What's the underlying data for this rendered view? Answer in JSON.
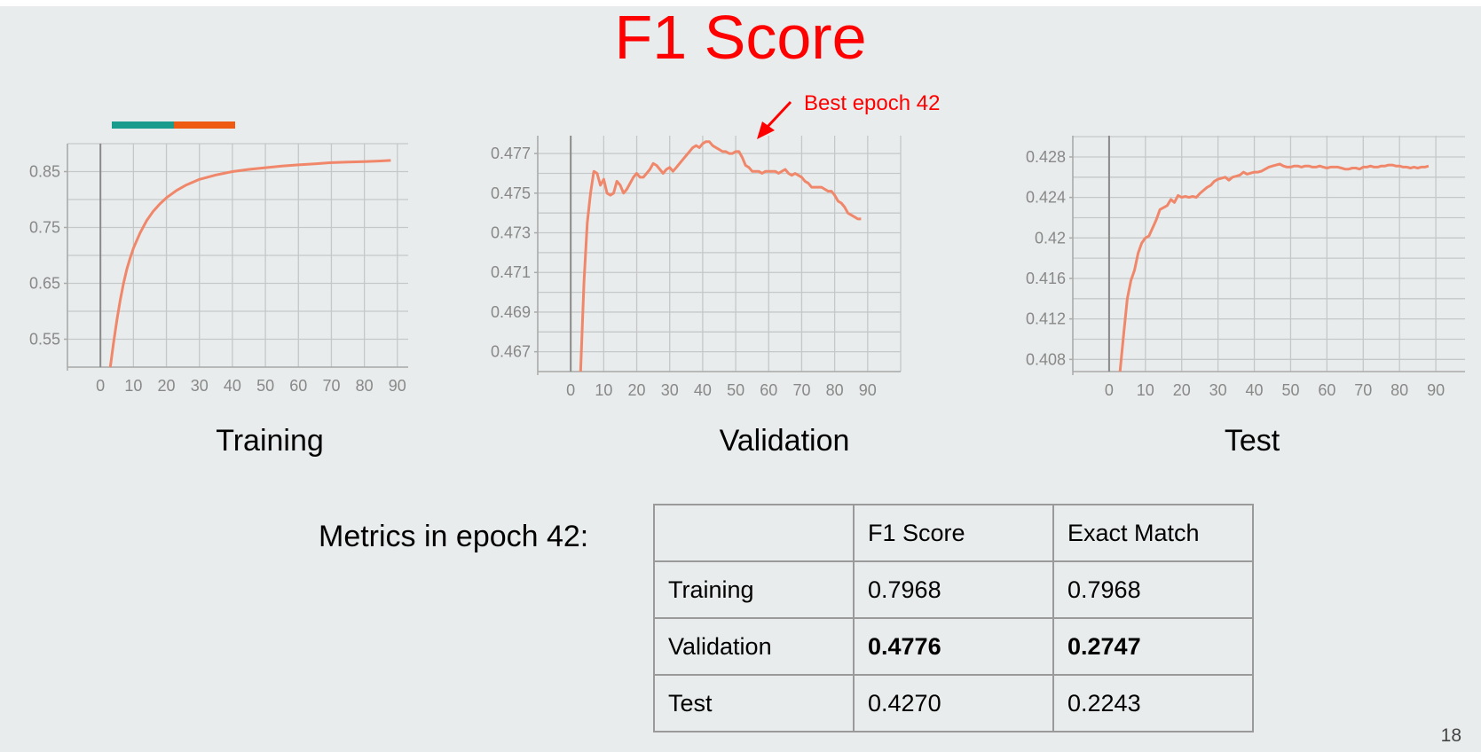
{
  "title": "F1 Score",
  "legend_colors": [
    "#1a9c8c",
    "#ef5a12"
  ],
  "annotation": {
    "text": "Best epoch 42",
    "color": "#ff0000"
  },
  "chart_data": [
    {
      "type": "line",
      "title": "Training",
      "xlabel": "",
      "ylabel": "",
      "x_ticks": [
        "0",
        "10",
        "20",
        "30",
        "40",
        "50",
        "60",
        "70",
        "80",
        "90"
      ],
      "y_ticks": [
        "0.85",
        "0.75",
        "0.65",
        "0.55"
      ],
      "xlim": [
        -10,
        100
      ],
      "ylim": [
        0.5,
        0.9
      ],
      "line_color": "#f0876a",
      "grid": true,
      "series": [
        {
          "x": [
            3,
            4,
            5,
            6,
            7,
            8,
            9,
            10,
            12,
            14,
            16,
            18,
            20,
            23,
            26,
            30,
            35,
            40,
            45,
            50,
            55,
            60,
            65,
            70,
            75,
            80,
            85,
            88
          ],
          "y": [
            0.5,
            0.545,
            0.585,
            0.62,
            0.65,
            0.675,
            0.695,
            0.713,
            0.74,
            0.762,
            0.779,
            0.792,
            0.803,
            0.816,
            0.826,
            0.836,
            0.844,
            0.85,
            0.854,
            0.857,
            0.86,
            0.862,
            0.864,
            0.866,
            0.867,
            0.868,
            0.869,
            0.87
          ]
        }
      ]
    },
    {
      "type": "line",
      "title": "Validation",
      "xlabel": "",
      "ylabel": "",
      "x_ticks": [
        "0",
        "10",
        "20",
        "30",
        "40",
        "50",
        "60",
        "70",
        "80",
        "90"
      ],
      "y_ticks": [
        "0.477",
        "0.475",
        "0.473",
        "0.471",
        "0.469",
        "0.467"
      ],
      "xlim": [
        -10,
        100
      ],
      "ylim": [
        0.466,
        0.4779
      ],
      "line_color": "#f0876a",
      "grid": true,
      "series": [
        {
          "x": [
            3,
            4,
            5,
            6,
            7,
            8,
            9,
            10,
            11,
            12,
            13,
            14,
            15,
            16,
            17,
            18,
            19,
            20,
            21,
            22,
            23,
            24,
            25,
            26,
            27,
            28,
            29,
            30,
            31,
            32,
            33,
            34,
            35,
            36,
            37,
            38,
            39,
            40,
            41,
            42,
            43,
            44,
            45,
            46,
            47,
            48,
            49,
            50,
            51,
            52,
            53,
            54,
            55,
            56,
            57,
            58,
            59,
            60,
            61,
            62,
            63,
            64,
            65,
            66,
            67,
            68,
            69,
            70,
            71,
            72,
            73,
            74,
            75,
            76,
            77,
            78,
            79,
            80,
            81,
            82,
            83,
            84,
            85,
            86,
            87,
            88
          ],
          "y": [
            0.466,
            0.4705,
            0.4735,
            0.475,
            0.4761,
            0.476,
            0.4754,
            0.4757,
            0.475,
            0.4749,
            0.475,
            0.4756,
            0.4754,
            0.475,
            0.4752,
            0.4755,
            0.4758,
            0.476,
            0.4758,
            0.4758,
            0.476,
            0.4762,
            0.4765,
            0.4764,
            0.4762,
            0.476,
            0.4762,
            0.4763,
            0.4761,
            0.4763,
            0.4765,
            0.4767,
            0.4769,
            0.4771,
            0.4773,
            0.4774,
            0.4773,
            0.4775,
            0.4776,
            0.4776,
            0.4774,
            0.4773,
            0.4772,
            0.4771,
            0.4771,
            0.477,
            0.477,
            0.4771,
            0.4771,
            0.4768,
            0.4764,
            0.4763,
            0.4761,
            0.4761,
            0.4761,
            0.476,
            0.4761,
            0.4761,
            0.4761,
            0.4761,
            0.476,
            0.4761,
            0.4762,
            0.476,
            0.4759,
            0.476,
            0.4759,
            0.4758,
            0.4756,
            0.4755,
            0.4753,
            0.4753,
            0.4753,
            0.4753,
            0.4752,
            0.4751,
            0.4751,
            0.4749,
            0.4746,
            0.4745,
            0.4743,
            0.474,
            0.4739,
            0.4738,
            0.4737,
            0.4737
          ]
        }
      ]
    },
    {
      "type": "line",
      "title": "Test",
      "xlabel": "",
      "ylabel": "",
      "x_ticks": [
        "0",
        "10",
        "20",
        "30",
        "40",
        "50",
        "60",
        "70",
        "80",
        "90"
      ],
      "y_ticks": [
        "0.428",
        "0.424",
        "0.42",
        "0.416",
        "0.412",
        "0.408"
      ],
      "xlim": [
        -10,
        100
      ],
      "ylim": [
        0.4068,
        0.4301
      ],
      "line_color": "#f0876a",
      "grid": true,
      "series": [
        {
          "x": [
            3,
            4,
            5,
            6,
            7,
            8,
            9,
            10,
            11,
            12,
            13,
            14,
            15,
            16,
            17,
            18,
            19,
            20,
            21,
            22,
            23,
            24,
            25,
            26,
            27,
            28,
            29,
            30,
            31,
            32,
            33,
            34,
            35,
            36,
            37,
            38,
            39,
            40,
            41,
            42,
            43,
            44,
            45,
            46,
            47,
            48,
            49,
            50,
            51,
            52,
            53,
            54,
            55,
            56,
            57,
            58,
            59,
            60,
            61,
            62,
            63,
            64,
            65,
            66,
            67,
            68,
            69,
            70,
            71,
            72,
            73,
            74,
            75,
            76,
            77,
            78,
            79,
            80,
            81,
            82,
            83,
            84,
            85,
            86,
            87,
            88
          ],
          "y": [
            0.4068,
            0.4105,
            0.414,
            0.4158,
            0.4168,
            0.4185,
            0.4195,
            0.42,
            0.4202,
            0.421,
            0.4218,
            0.4228,
            0.423,
            0.4232,
            0.4238,
            0.4235,
            0.4242,
            0.424,
            0.4241,
            0.424,
            0.4241,
            0.424,
            0.4244,
            0.4247,
            0.425,
            0.4252,
            0.4256,
            0.4258,
            0.4259,
            0.426,
            0.4257,
            0.426,
            0.4261,
            0.4262,
            0.4265,
            0.4263,
            0.4264,
            0.4265,
            0.4265,
            0.4266,
            0.4268,
            0.427,
            0.4271,
            0.4272,
            0.4273,
            0.4271,
            0.427,
            0.427,
            0.4271,
            0.4271,
            0.427,
            0.4271,
            0.4271,
            0.427,
            0.427,
            0.4271,
            0.427,
            0.4269,
            0.427,
            0.427,
            0.427,
            0.4269,
            0.4268,
            0.4268,
            0.4269,
            0.4269,
            0.4268,
            0.427,
            0.427,
            0.4271,
            0.427,
            0.427,
            0.4271,
            0.4271,
            0.4272,
            0.4272,
            0.4271,
            0.4271,
            0.427,
            0.427,
            0.4269,
            0.427,
            0.4269,
            0.427,
            0.427,
            0.4271
          ]
        }
      ]
    }
  ],
  "metrics": {
    "label": "Metrics in epoch 42:",
    "header": [
      "",
      "F1 Score",
      "Exact Match"
    ],
    "rows": [
      {
        "name": "Training",
        "f1": "0.7968",
        "em": "0.7968"
      },
      {
        "name": "Validation",
        "f1": "0.4776",
        "em": "0.2747"
      },
      {
        "name": "Test",
        "f1": "0.4270",
        "em": "0.2243"
      }
    ]
  },
  "page_number": "18"
}
